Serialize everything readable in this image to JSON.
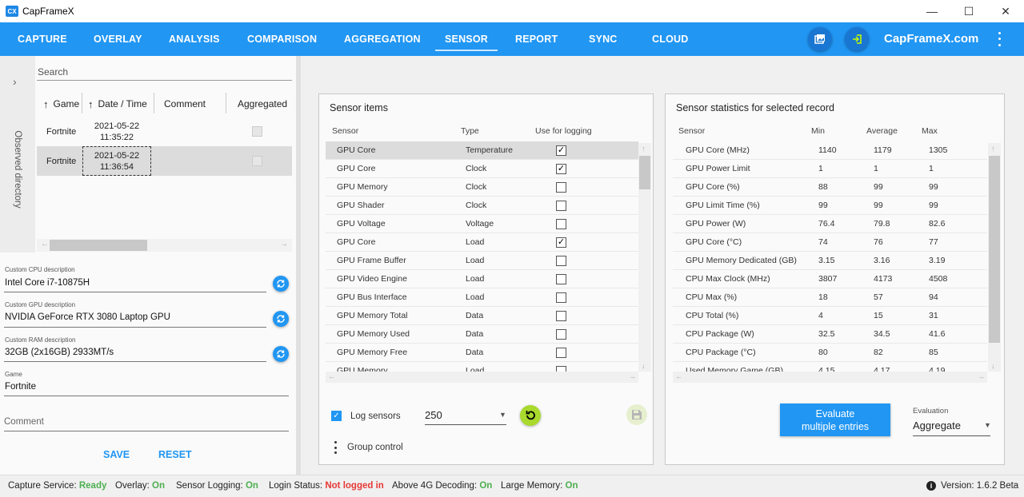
{
  "window": {
    "title": "CapFrameX",
    "logo_text": "CX"
  },
  "nav": {
    "tabs": [
      "CAPTURE",
      "OVERLAY",
      "ANALYSIS",
      "COMPARISON",
      "AGGREGATION",
      "SENSOR",
      "REPORT",
      "SYNC",
      "CLOUD"
    ],
    "active": "SENSOR",
    "brand": "CapFrameX.com",
    "accent_color": "#2196f3"
  },
  "left": {
    "observed_directory": "Observed directory",
    "search_placeholder": "Search",
    "columns": {
      "game": "Game",
      "date": "Date / Time",
      "comment": "Comment",
      "aggregated": "Aggregated"
    },
    "rows": [
      {
        "game": "Fortnite",
        "date": "2021-05-22",
        "time": "11:35:22"
      },
      {
        "game": "Fortnite",
        "date": "2021-05-22",
        "time": "11:36:54"
      }
    ],
    "cpu_label": "Custom CPU description",
    "cpu_value": "Intel Core i7-10875H",
    "gpu_label": "Custom GPU description",
    "gpu_value": "NVIDIA GeForce RTX 3080 Laptop GPU",
    "ram_label": "Custom RAM description",
    "ram_value": "32GB (2x16GB) 2933MT/s",
    "game_label": "Game",
    "game_value": "Fortnite",
    "comment_placeholder": "Comment",
    "save": "SAVE",
    "reset": "RESET"
  },
  "sensor_items": {
    "title": "Sensor items",
    "col_sensor": "Sensor",
    "col_type": "Type",
    "col_logging": "Use for logging",
    "rows": [
      {
        "sensor": "GPU Core",
        "type": "Temperature",
        "checked": true
      },
      {
        "sensor": "GPU Core",
        "type": "Clock",
        "checked": true
      },
      {
        "sensor": "GPU Memory",
        "type": "Clock",
        "checked": false
      },
      {
        "sensor": "GPU Shader",
        "type": "Clock",
        "checked": false
      },
      {
        "sensor": "GPU Voltage",
        "type": "Voltage",
        "checked": false
      },
      {
        "sensor": "GPU Core",
        "type": "Load",
        "checked": true
      },
      {
        "sensor": "GPU Frame Buffer",
        "type": "Load",
        "checked": false
      },
      {
        "sensor": "GPU Video Engine",
        "type": "Load",
        "checked": false
      },
      {
        "sensor": "GPU Bus Interface",
        "type": "Load",
        "checked": false
      },
      {
        "sensor": "GPU Memory Total",
        "type": "Data",
        "checked": false
      },
      {
        "sensor": "GPU Memory Used",
        "type": "Data",
        "checked": false
      },
      {
        "sensor": "GPU Memory Free",
        "type": "Data",
        "checked": false
      },
      {
        "sensor": "GPU Memory",
        "type": "Load",
        "checked": false
      }
    ],
    "log_sensors_label": "Log sensors",
    "interval": "250",
    "group_control": "Group control"
  },
  "stats": {
    "title": "Sensor statistics for selected record",
    "col_sensor": "Sensor",
    "col_min": "Min",
    "col_avg": "Average",
    "col_max": "Max",
    "rows": [
      {
        "sensor": "GPU Core (MHz)",
        "min": "1140",
        "avg": "1179",
        "max": "1305"
      },
      {
        "sensor": "GPU Power Limit",
        "min": "1",
        "avg": "1",
        "max": "1"
      },
      {
        "sensor": "GPU Core (%)",
        "min": "88",
        "avg": "99",
        "max": "99"
      },
      {
        "sensor": "GPU Limit Time (%)",
        "min": "99",
        "avg": "99",
        "max": "99"
      },
      {
        "sensor": "GPU Power (W)",
        "min": "76.4",
        "avg": "79.8",
        "max": "82.6"
      },
      {
        "sensor": "GPU Core (°C)",
        "min": "74",
        "avg": "76",
        "max": "77"
      },
      {
        "sensor": "GPU Memory Dedicated (GB)",
        "min": "3.15",
        "avg": "3.16",
        "max": "3.19"
      },
      {
        "sensor": "CPU Max Clock (MHz)",
        "min": "3807",
        "avg": "4173",
        "max": "4508"
      },
      {
        "sensor": "CPU Max (%)",
        "min": "18",
        "avg": "57",
        "max": "94"
      },
      {
        "sensor": "CPU Total (%)",
        "min": "4",
        "avg": "15",
        "max": "31"
      },
      {
        "sensor": "CPU Package (W)",
        "min": "32.5",
        "avg": "34.5",
        "max": "41.6"
      },
      {
        "sensor": "CPU Package (°C)",
        "min": "80",
        "avg": "82",
        "max": "85"
      },
      {
        "sensor": "Used Memory Game (GB)",
        "min": "4.15",
        "avg": "4.17",
        "max": "4.19"
      }
    ],
    "evaluate_button": "Evaluate multiple entries",
    "evaluate_line1": "Evaluate",
    "evaluate_line2": "multiple entries",
    "evaluation_label": "Evaluation",
    "evaluation_value": "Aggregate"
  },
  "status": {
    "capture_label": "Capture Service:",
    "capture_value": "Ready",
    "overlay_label": "Overlay:",
    "overlay_value": "On",
    "logging_label": "Sensor Logging:",
    "logging_value": "On",
    "login_label": "Login Status:",
    "login_value": "Not logged in",
    "above4g_label": "Above 4G Decoding:",
    "above4g_value": "On",
    "largemem_label": "Large Memory:",
    "largemem_value": "On",
    "version_label": "Version:",
    "version_value": "1.6.2 Beta"
  }
}
